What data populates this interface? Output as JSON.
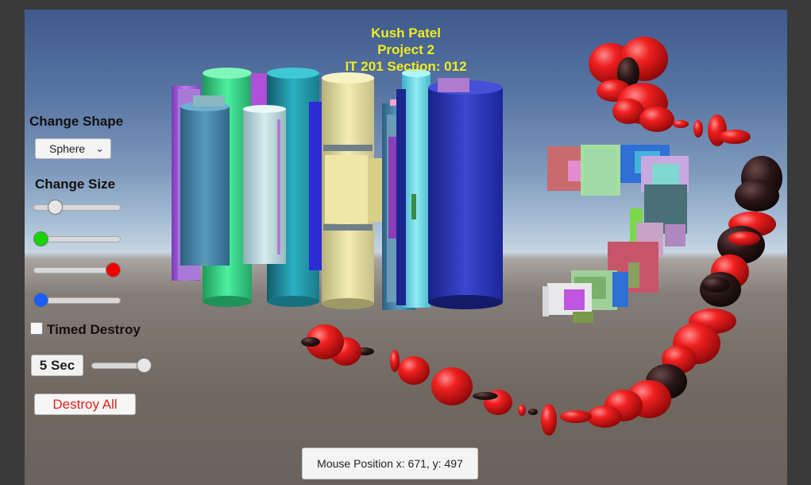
{
  "header": {
    "lines": [
      "Kush Patel",
      "Project 2",
      "IT 201 Section: 012"
    ]
  },
  "panel": {
    "change_shape_label": "Change Shape",
    "shape_dropdown_value": "Sphere",
    "change_size_label": "Change Size",
    "size_slider_value": 0.2,
    "red_slider_value": 0.0,
    "green_slider_value": 1.0,
    "blue_slider_value": 0.0,
    "handle_colors": {
      "size": "#e6e6e6",
      "red": "#18d400",
      "green": "#f00000",
      "blue": "#1c5cf5"
    },
    "timed_destroy_label": "Timed Destroy",
    "timed_destroy_checked": false,
    "seconds_label": "5 Sec",
    "seconds_slider_value": 1.0,
    "destroy_all_label": "Destroy All"
  },
  "status": {
    "mouse_position_text": "Mouse Position x: 671, y:  497"
  }
}
